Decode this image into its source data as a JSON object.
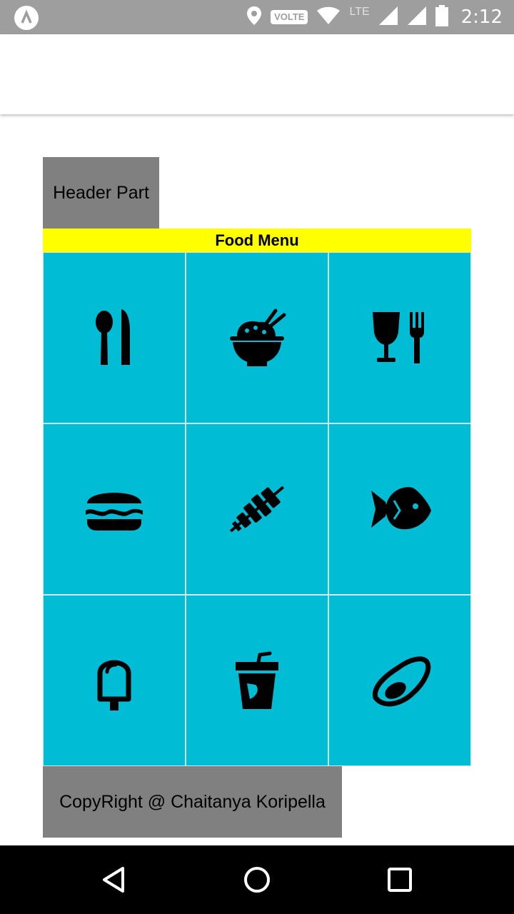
{
  "status_bar": {
    "network_badge": "VOLTE",
    "network_type": "LTE",
    "time": "2:12",
    "icons": [
      "location-icon",
      "wifi-icon",
      "signal-icon",
      "signal-icon",
      "battery-icon"
    ]
  },
  "header": {
    "label": "Header Part"
  },
  "menu": {
    "title": "Food Menu",
    "items": [
      {
        "icon": "utensils-icon"
      },
      {
        "icon": "rice-bowl-icon"
      },
      {
        "icon": "wine-fork-icon"
      },
      {
        "icon": "hamburger-icon"
      },
      {
        "icon": "kebab-icon"
      },
      {
        "icon": "fish-icon"
      },
      {
        "icon": "ice-cream-icon"
      },
      {
        "icon": "drink-cup-icon"
      },
      {
        "icon": "avocado-icon"
      }
    ]
  },
  "footer": {
    "label": "CopyRight @ Chaitanya Koripella"
  },
  "colors": {
    "status_bar": "#9e9e9e",
    "header_bg": "#808080",
    "title_bg": "#ffff00",
    "cell_bg": "#00bcd4",
    "nav_bar": "#000000"
  }
}
